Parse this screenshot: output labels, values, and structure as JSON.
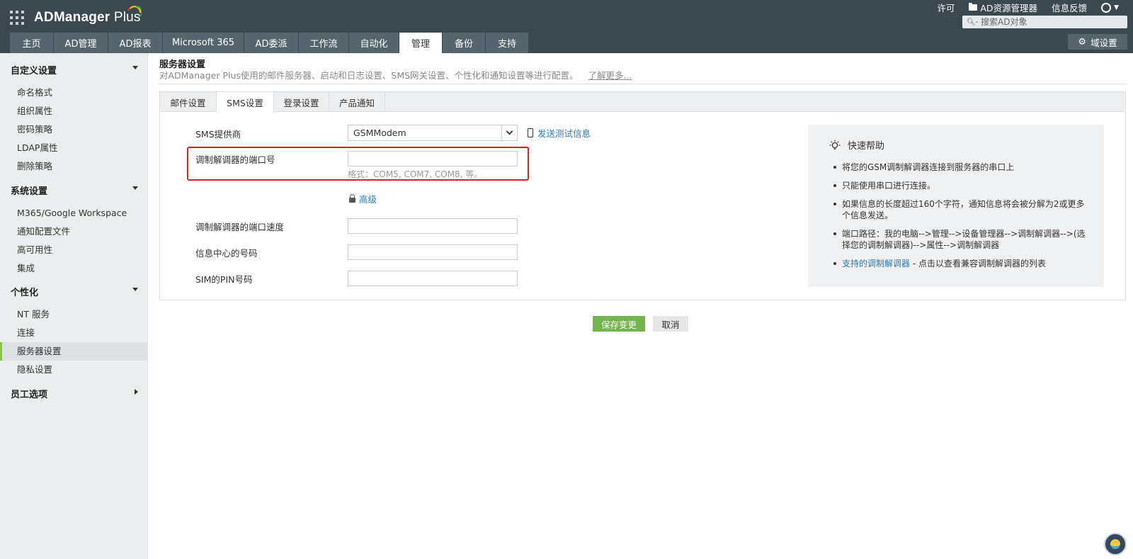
{
  "app": {
    "logo_main": "ADManager",
    "logo_plus": " Plus"
  },
  "top_links": {
    "license": "许可",
    "ad_explorer": "AD资源管理器",
    "feedback": "信息反馈"
  },
  "search": {
    "placeholder": "搜索AD对象"
  },
  "domain_settings": "域设置",
  "tabs": [
    "主页",
    "AD管理",
    "AD报表",
    "Microsoft 365",
    "AD委派",
    "工作流",
    "自动化",
    "管理",
    "备份",
    "支持"
  ],
  "active_tab": "管理",
  "sidebar": {
    "sections": [
      {
        "title": "自定义设置",
        "items": [
          "命名格式",
          "组织属性",
          "密码策略",
          "LDAP属性",
          "删除策略"
        ]
      },
      {
        "title": "系统设置",
        "items": [
          "M365/Google Workspace",
          "通知配置文件",
          "高可用性",
          "集成"
        ]
      },
      {
        "title": "个性化",
        "items": [
          "NT 服务",
          "连接",
          "服务器设置",
          "隐私设置"
        ]
      },
      {
        "title": "员工选项",
        "items": []
      }
    ],
    "active_item": "服务器设置"
  },
  "page": {
    "title": "服务器设置",
    "description": "对ADManager Plus使用的邮件服务器、启动和日志设置、SMS网关设置、个性化和通知设置等进行配置。",
    "learn_more": "了解更多..."
  },
  "subtabs": [
    "邮件设置",
    "SMS设置",
    "登录设置",
    "产品通知"
  ],
  "active_subtab": "SMS设置",
  "form": {
    "provider_label": "SMS提供商",
    "provider_value": "GSMModem",
    "send_test": "发送测试信息",
    "port_label": "调制解调器的端口号",
    "port_value": "",
    "port_hint": "格式：COM5, COM7, COM8, 等。",
    "advanced": "高级",
    "speed_label": "调制解调器的端口速度",
    "speed_value": "",
    "center_label": "信息中心的号码",
    "center_value": "",
    "pin_label": "SIM的PIN号码",
    "pin_value": ""
  },
  "help": {
    "title": "快速帮助",
    "items": [
      "将您的GSM调制解调器连接到服务器的串口上",
      "只能使用串口进行连接。",
      "如果信息的长度超过160个字符，通知信息将会被分解为2或更多个信息发送。",
      "端口路径：我的电脑-->管理-->设备管理器-->调制解调器-->(选择您的调制解调器)-->属性-->调制解调器"
    ],
    "supported_link": "支持的调制解调器",
    "supported_rest": " - 点击以查看兼容调制解调器的列表"
  },
  "buttons": {
    "save": "保存变更",
    "cancel": "取消"
  },
  "colors": {
    "header": "#3b4850",
    "tab": "#56656d",
    "save": "#73b54b",
    "highlight": "#e0201b",
    "link": "#2a7ab8"
  }
}
